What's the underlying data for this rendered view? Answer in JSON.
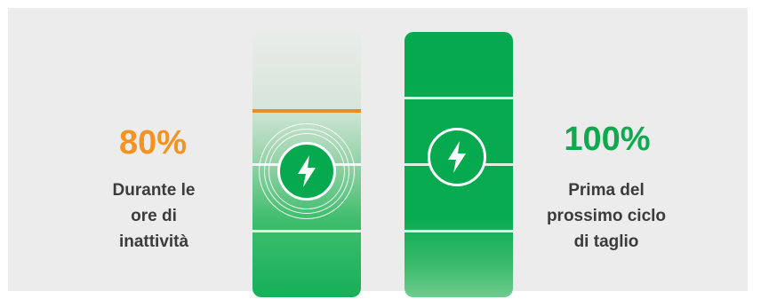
{
  "left": {
    "percent": "80%",
    "caption_lines": [
      "Durante le",
      "ore di",
      "inattività"
    ],
    "charge_level": 0.8
  },
  "right": {
    "percent": "100%",
    "caption_lines": [
      "Prima del",
      "prossimo ciclo",
      "di taglio"
    ],
    "charge_level": 1.0
  },
  "colors": {
    "orange": "#f39322",
    "green": "#10a950",
    "charge_line": "#f08c1e",
    "panel": "#ececec"
  },
  "icons": {
    "left": "lightning-bolt-icon",
    "right": "lightning-bolt-icon"
  }
}
